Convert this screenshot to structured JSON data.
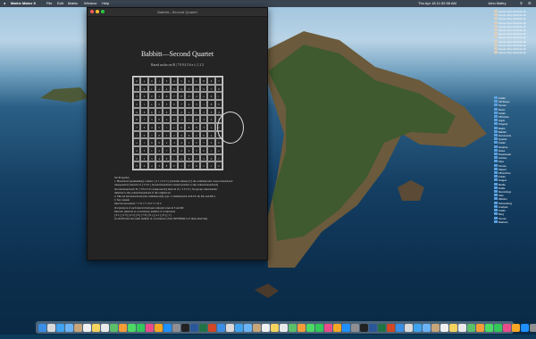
{
  "menubar": {
    "apple": "",
    "app_name": "Matrix Maker II",
    "menus": [
      "File",
      "Edit",
      "Matrix",
      "Window",
      "Help"
    ],
    "clock": "Thu Apr 18  11:52:58 AM",
    "user": "John Mallry"
  },
  "window": {
    "title": "Babbitt—Second Quartet"
  },
  "document": {
    "title": "Babbitt—Second Quartet",
    "subtitle": "Based on the set B | 7 8 9 4 5 6 e t | 1 2 3",
    "matrix": [
      [
        "0",
        "e",
        "9",
        "t",
        "3",
        "4",
        "5",
        "2",
        "1",
        "8",
        "6",
        "7"
      ],
      [
        "1",
        "0",
        "t",
        "e",
        "4",
        "5",
        "6",
        "3",
        "2",
        "9",
        "7",
        "8"
      ],
      [
        "3",
        "2",
        "0",
        "1",
        "6",
        "7",
        "8",
        "5",
        "4",
        "e",
        "9",
        "t"
      ],
      [
        "2",
        "1",
        "e",
        "0",
        "5",
        "6",
        "7",
        "4",
        "3",
        "t",
        "8",
        "9"
      ],
      [
        "9",
        "8",
        "6",
        "7",
        "0",
        "1",
        "2",
        "e",
        "t",
        "5",
        "3",
        "4"
      ],
      [
        "8",
        "7",
        "5",
        "6",
        "e",
        "0",
        "1",
        "t",
        "9",
        "4",
        "2",
        "3"
      ],
      [
        "7",
        "6",
        "4",
        "5",
        "t",
        "e",
        "0",
        "9",
        "8",
        "3",
        "1",
        "2"
      ],
      [
        "t",
        "9",
        "7",
        "8",
        "1",
        "2",
        "3",
        "0",
        "e",
        "6",
        "4",
        "5"
      ],
      [
        "e",
        "t",
        "8",
        "9",
        "2",
        "3",
        "4",
        "1",
        "0",
        "7",
        "5",
        "6"
      ],
      [
        "4",
        "3",
        "1",
        "2",
        "7",
        "8",
        "9",
        "6",
        "5",
        "0",
        "t",
        "e"
      ],
      [
        "6",
        "5",
        "3",
        "4",
        "9",
        "t",
        "e",
        "8",
        "7",
        "2",
        "0",
        "1"
      ],
      [
        "5",
        "4",
        "2",
        "3",
        "8",
        "9",
        "t",
        "7",
        "6",
        "e",
        "1",
        "0"
      ]
    ],
    "properties_heading": "Set Properties",
    "properties": [
      "1. Hexachord (nonmember) content: { 0 1 2 3 4 5 } Invariant subsets (?): all-combinatorial, Source hexachord:",
      "   transposed by interval of { T 0 6 } Second hexachord content (relative to the ordered hexachord)",
      "   Second hexachord: B | 7 8 9 4 5 6 | transposed by interval of { T 3 T 9 } Set-group characteristic",
      "   identical to the ordered hexachord of the original set",
      "2. This set has hexachords (all-combinatorial), type 1 combinatorial with T0, I6, R0, and RI11.",
      "3. Set content:",
      "   Interval succession: + 1 8 1 7 1 8 2 7 1 10 2",
      "   Occurrences of each interval between adjacent tones in S and RI:",
      "               Interval: (interval as occurrence), number of occurrences",
      "   [ 0 1 ] [ 2 3 ] [ 4 5 ] [ 6 ] [ 7 8 ] [ 9 t ] [ e 1 ] [ 0 ] [ 1 ]",
      "   (S and RI have the same number of occurrences of the INTERVALS of these intervals)"
    ]
  },
  "desktop_stack": {
    "items": [
      "Screen Shot 2019-04-18",
      "Screen Shot 2019-04-18",
      "Screen Shot 2019-04-18",
      "Screen Shot 2019-04-18",
      "Screen Shot 2019-04-18",
      "Screen Shot 2019-04-18",
      "Screen Shot 2019-04-18",
      "Screen Shot 2019-04-18",
      "Screen Shot 2019-04-18",
      "Screen Shot 2019-04-18",
      "Screen Shot 2019-04-18",
      "Screen Shot 2019-04-18"
    ],
    "folders": [
      "Folder",
      "FB Shoes",
      "Scores",
      "Music",
      "Folder",
      "FB Notes",
      "Apple",
      "Projects",
      "Matrix",
      "Babbitt",
      "Documents",
      "Quartet",
      "Folder",
      "Desktop",
      "Notes",
      "Downloads",
      "Archive",
      "Files",
      "Scores",
      "Papers",
      "FB Archive",
      "Folder",
      "Images",
      "Media",
      "Drafts",
      "Recordings",
      "Sets",
      "Webern",
      "Schoenberg",
      "Analysis",
      "Folder",
      "Berg",
      "Scores",
      "Matrices"
    ]
  },
  "colors": {
    "close": "#ff5f57",
    "minimize": "#febc2e",
    "zoom": "#28c840",
    "window_bg": "#242424",
    "menubar_bg": "#2c323c"
  },
  "dock_icons": [
    "finder",
    "launchpad",
    "safari",
    "mail",
    "contacts",
    "calendar",
    "notes",
    "reminders",
    "maps",
    "photos",
    "messages",
    "facetime",
    "itunes",
    "books",
    "app-store",
    "preferences",
    "terminal",
    "word",
    "excel",
    "powerpoint",
    "matrix-maker",
    "preview",
    "pages",
    "numbers",
    "keynote",
    "garageband",
    "logic",
    "sibelius",
    "finale",
    "chrome",
    "firefox",
    "skype",
    "zoom",
    "slack",
    "dropbox",
    "textedit",
    "activity",
    "calculator",
    "dictionary",
    "stickies",
    "font-book",
    "chess",
    "photo-booth",
    "quicktime",
    "audio-midi",
    "bluetooth",
    "disk-utility",
    "console",
    "script-editor",
    "time-machine",
    "xcode",
    "sketch",
    "spotify",
    "vlc",
    "downloads",
    "trash"
  ]
}
